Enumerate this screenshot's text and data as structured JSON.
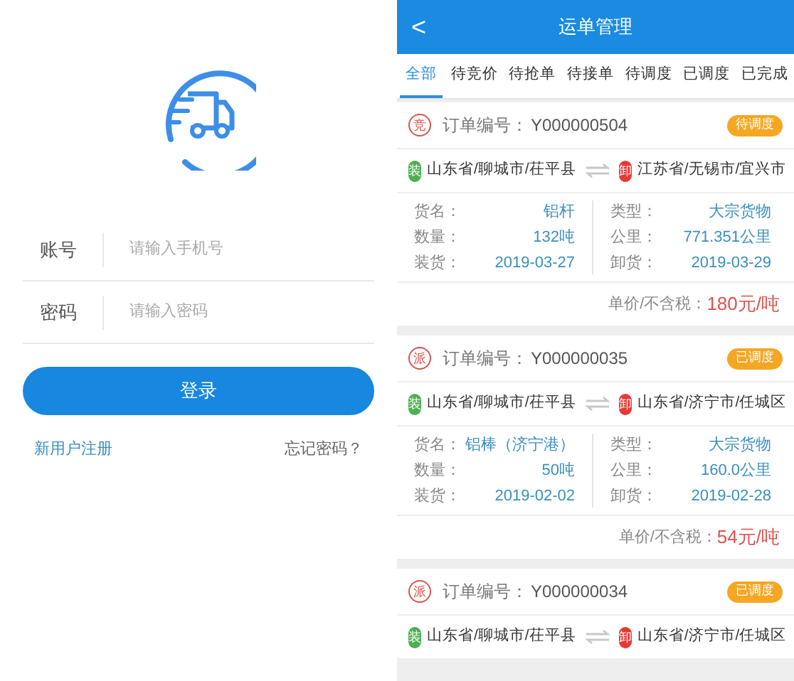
{
  "login": {
    "account_label": "账号",
    "account_placeholder": "请输入手机号",
    "password_label": "密码",
    "password_placeholder": "请输入密码",
    "login_button": "登录",
    "register_link": "新用户注册",
    "forgot_link": "忘记密码？"
  },
  "app": {
    "back": "<",
    "title": "运单管理",
    "tabs": [
      {
        "label": "全部",
        "selected": true
      },
      {
        "label": "待竞价",
        "selected": false
      },
      {
        "label": "待抢单",
        "selected": false
      },
      {
        "label": "待接单",
        "selected": false
      },
      {
        "label": "待调度",
        "selected": false
      },
      {
        "label": "已调度",
        "selected": false
      },
      {
        "label": "已完成",
        "selected": false
      }
    ],
    "orders": [
      {
        "type_badge": "竞",
        "order_label": "订单编号：",
        "order_no": "Y000000504",
        "status": "待调度",
        "from_badge": "装",
        "from": "山东省/聊城市/茌平县",
        "to_badge": "卸",
        "to": "江苏省/无锡市/宜兴市",
        "left_details": [
          {
            "label": "货名：",
            "value": "铝杆"
          },
          {
            "label": "数量：",
            "value": "132吨"
          },
          {
            "label": "装货：",
            "value": "2019-03-27"
          }
        ],
        "right_details": [
          {
            "label": "类型：",
            "value": "大宗货物"
          },
          {
            "label": "公里：",
            "value": "771.351公里"
          },
          {
            "label": "卸货：",
            "value": "2019-03-29"
          }
        ],
        "price_label": "单价/不含税：",
        "price": "180元/吨"
      },
      {
        "type_badge": "派",
        "order_label": "订单编号：",
        "order_no": "Y000000035",
        "status": "已调度",
        "from_badge": "装",
        "from": "山东省/聊城市/茌平县",
        "to_badge": "卸",
        "to": "山东省/济宁市/任城区",
        "left_details": [
          {
            "label": "货名：",
            "value": "铝棒（济宁港）"
          },
          {
            "label": "数量：",
            "value": "50吨"
          },
          {
            "label": "装货：",
            "value": "2019-02-02"
          }
        ],
        "right_details": [
          {
            "label": "类型：",
            "value": "大宗货物"
          },
          {
            "label": "公里：",
            "value": "160.0公里"
          },
          {
            "label": "卸货：",
            "value": "2019-02-28"
          }
        ],
        "price_label": "单价/不含税：",
        "price": "54元/吨"
      },
      {
        "type_badge": "派",
        "order_label": "订单编号：",
        "order_no": "Y000000034",
        "status": "已调度",
        "from_badge": "装",
        "from": "山东省/聊城市/茌平县",
        "to_badge": "卸",
        "to": "山东省/济宁市/任城区"
      }
    ]
  }
}
